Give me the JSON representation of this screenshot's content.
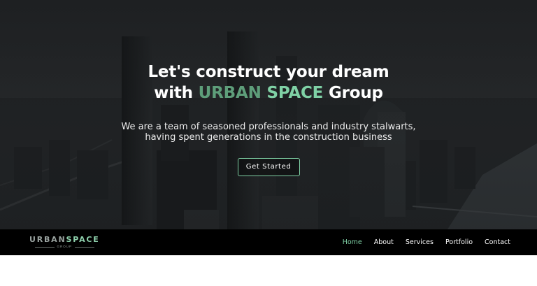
{
  "hero": {
    "title_line1": "Let's construct your dream",
    "title_with": "with ",
    "title_accent1": "URBAN",
    "title_space": " ",
    "title_accent2": "SPACE",
    "title_end": " Group",
    "subtitle_line1": "We are a team of seasoned professionals and industry stalwarts,",
    "subtitle_line2": "having spent generations in the construction business",
    "cta_label": "Get Started"
  },
  "brand": {
    "name_part1": "URBAN",
    "name_part2": "SPACE",
    "tagline": "GROUP"
  },
  "nav": {
    "items": [
      {
        "label": "Home",
        "active": true
      },
      {
        "label": "About",
        "active": false
      },
      {
        "label": "Services",
        "active": false
      },
      {
        "label": "Portfolio",
        "active": false
      },
      {
        "label": "Contact",
        "active": false
      }
    ]
  },
  "colors": {
    "accent": "#7fd1a5",
    "accent_dark": "#5e9e7a",
    "navbar_bg": "#000000",
    "hero_bg": "#1e2022"
  }
}
